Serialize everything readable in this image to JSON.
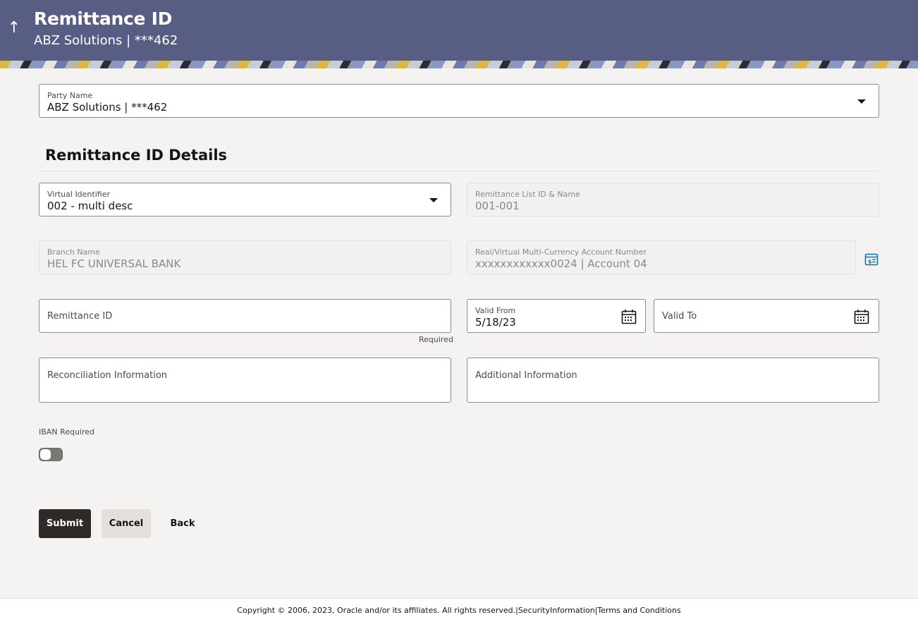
{
  "header": {
    "title": "Remittance ID",
    "subtitle": "ABZ Solutions | ***462",
    "back_icon": "up-arrow",
    "bg_color": "#575d83"
  },
  "party": {
    "label": "Party Name",
    "value": "ABZ Solutions | ***462"
  },
  "section": {
    "title": "Remittance ID Details"
  },
  "fields": {
    "virtual_identifier": {
      "label": "Virtual Identifier",
      "value": "002 - multi desc"
    },
    "remittance_list": {
      "label": "Remittance List ID & Name",
      "value": "001-001"
    },
    "branch_name": {
      "label": "Branch Name",
      "value": "HEL FC UNIVERSAL BANK"
    },
    "account_number": {
      "label": "Real/Virtual Multi-Currency Account Number",
      "value": "xxxxxxxxxxxx0024 | Account 04"
    },
    "remittance_id": {
      "placeholder": "Remittance ID",
      "helper": "Required"
    },
    "valid_from": {
      "label": "Valid From",
      "value": "5/18/23"
    },
    "valid_to": {
      "placeholder": "Valid To"
    },
    "reconciliation": {
      "placeholder": "Reconciliation Information"
    },
    "additional": {
      "placeholder": "Additional Information"
    }
  },
  "iban": {
    "label": "IBAN Required",
    "enabled": false
  },
  "buttons": {
    "submit": "Submit",
    "cancel": "Cancel",
    "back": "Back"
  },
  "footer": {
    "text": "Copyright © 2006, 2023, Oracle and/or its affiliates. All rights reserved.|SecurityInformation|Terms and Conditions"
  }
}
